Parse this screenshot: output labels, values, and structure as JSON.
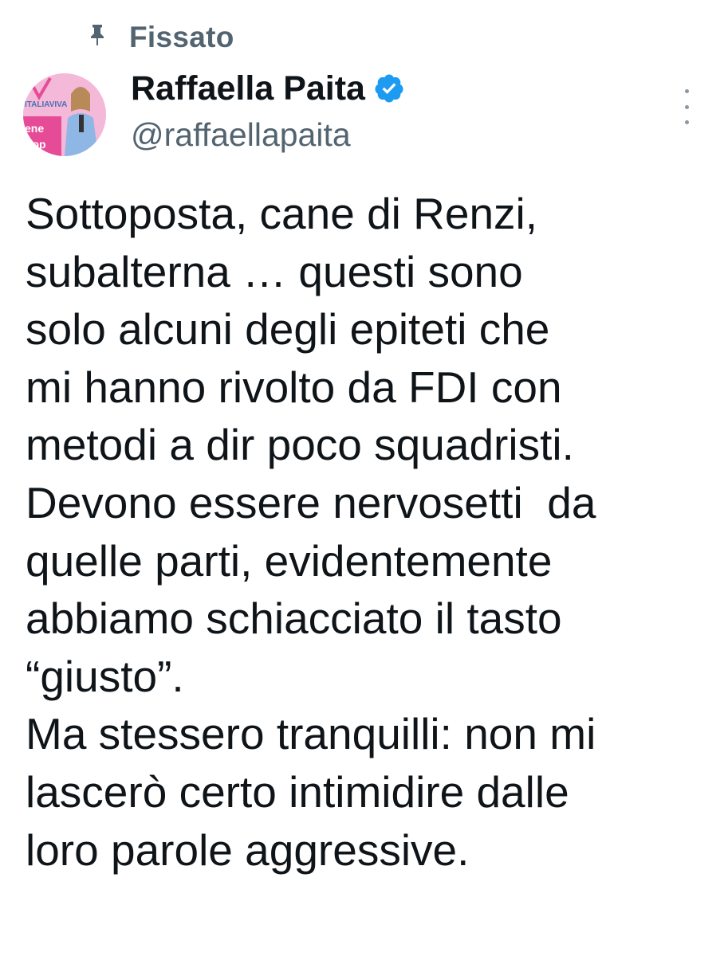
{
  "pinned": {
    "label": "Fissato",
    "icon": "pin-icon"
  },
  "author": {
    "name": "Raffaella Paita",
    "handle": "@raffaellapaita",
    "verified": true,
    "verified_icon": "verified-badge-icon",
    "avatar_text_top": "ITALIAVIVA",
    "avatar_text_left": "ene\nrop"
  },
  "menu": {
    "icon": "more-options-icon"
  },
  "tweet": {
    "lines": [
      "Sottoposta, cane di Renzi,",
      "subalterna … questi sono",
      "solo alcuni degli epiteti che",
      "mi hanno rivolto da FDI con",
      "metodi a dir poco squadristi.",
      "Devono essere nervosetti  da",
      "quelle parti, evidentemente",
      "abbiamo schiacciato il tasto",
      "“giusto”.",
      "Ma stessero tranquilli: non mi",
      "lascerò certo intimidire dalle",
      "loro parole aggressive."
    ]
  },
  "colors": {
    "text": "#0f1419",
    "secondary": "#536471",
    "verified": "#1d9bf0",
    "avatar_bg": "#f4b8d8"
  }
}
